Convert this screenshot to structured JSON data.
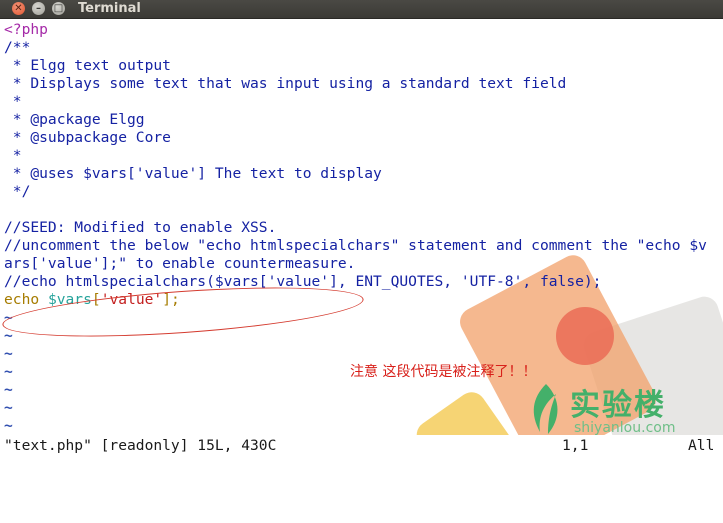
{
  "window": {
    "title": "Terminal",
    "close_glyph": "✕",
    "min_glyph": "–",
    "max_glyph": "□"
  },
  "code": {
    "lines": [
      {
        "type": "tag",
        "text": "<?php"
      },
      {
        "type": "comment",
        "text": "/**"
      },
      {
        "type": "comment",
        "text": " * Elgg text output"
      },
      {
        "type": "comment",
        "text": " * Displays some text that was input using a standard text field"
      },
      {
        "type": "comment",
        "text": " *"
      },
      {
        "type": "comment",
        "text": " * @package Elgg"
      },
      {
        "type": "comment",
        "text": " * @subpackage Core"
      },
      {
        "type": "comment",
        "text": " *"
      },
      {
        "type": "comment",
        "text": " * @uses $vars['value'] The text to display"
      },
      {
        "type": "comment",
        "text": " */"
      },
      {
        "type": "blank",
        "text": ""
      },
      {
        "type": "comment",
        "text": "//SEED: Modified to enable XSS."
      },
      {
        "type": "comment",
        "text": "//uncomment the below \"echo htmlspecialchars\" statement and comment the \"echo $v"
      },
      {
        "type": "comment",
        "text": "ars['value'];\" to enable countermeasure."
      },
      {
        "type": "comment",
        "text": "//echo htmlspecialchars($vars['value'], ENT_QUOTES, 'UTF-8', false);"
      },
      {
        "type": "echo",
        "kw": "echo",
        "var": "$vars",
        "str": "'value'",
        "rest": "];"
      }
    ],
    "tilde": "~",
    "tilde_count": 7,
    "annotation": "注意  这段代码是被注释了！！"
  },
  "status": {
    "file": "\"text.php\" [readonly] 15L, 430C",
    "position": "1,1",
    "scroll": "All"
  },
  "wallpaper": {
    "brand_cn": "实验楼",
    "brand_en": "shiyanlou.com"
  }
}
